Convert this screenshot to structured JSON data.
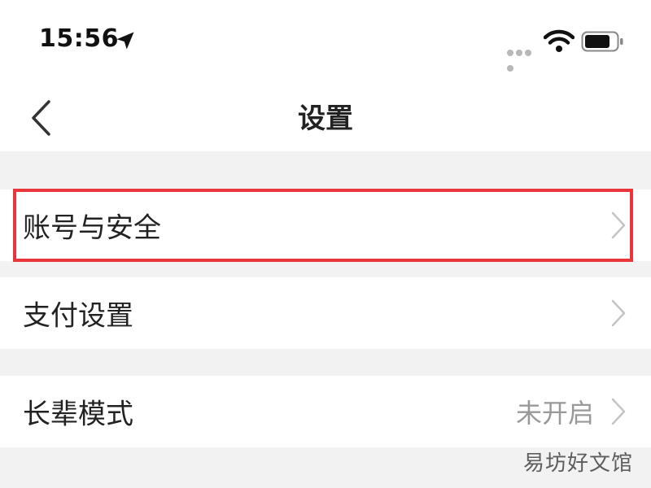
{
  "status_bar": {
    "time": "15:56",
    "location_icon": "location-arrow-icon",
    "signal_icon": "cellular-signal-icon",
    "wifi_icon": "wifi-icon",
    "battery_icon": "battery-icon"
  },
  "nav": {
    "title": "设置",
    "back_icon": "chevron-left-icon"
  },
  "settings": {
    "items": [
      {
        "label": "账号与安全",
        "value": ""
      },
      {
        "label": "支付设置",
        "value": ""
      },
      {
        "label": "长辈模式",
        "value": "未开启"
      }
    ]
  },
  "highlight_color": "#e8363b",
  "watermark": "易坊好文馆"
}
